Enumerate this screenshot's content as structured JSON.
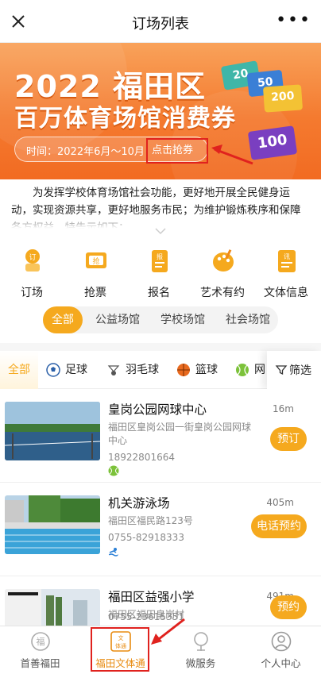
{
  "titlebar": {
    "title": "订场列表"
  },
  "banner": {
    "line1": "2022 福田区",
    "line2": "百万体育场馆消费券",
    "time": "时间：2022年6月～10月",
    "grab_label": "点击抢券",
    "coupons": [
      "20",
      "50",
      "200",
      "100"
    ]
  },
  "notice": {
    "text": "为发挥学校体育场馆社会功能，更好地开展全民健身运动，实现资源共享，更好地服务市民；为维护锻炼秩序和保障各方权益，特告示如下："
  },
  "nav_icons": [
    {
      "label": "订场",
      "color": "#f5a91e"
    },
    {
      "label": "抢票",
      "color": "#f5a91e"
    },
    {
      "label": "报名",
      "color": "#f5a91e"
    },
    {
      "label": "艺术有约",
      "color": "#f5a91e"
    },
    {
      "label": "文体信息",
      "color": "#f5a91e"
    }
  ],
  "venue_filters": {
    "items": [
      "全部",
      "公益场馆",
      "学校场馆",
      "社会场馆"
    ],
    "active": "全部"
  },
  "sports": {
    "items": [
      "全部",
      "足球",
      "羽毛球",
      "篮球",
      "网"
    ],
    "active": "全部",
    "filter_label": "筛选"
  },
  "venues": [
    {
      "name": "皇岗公园网球中心",
      "distance": "16m",
      "address": "福田区皇岗公园一街皇岗公园网球中心",
      "phone": "18922801664",
      "action": "预订",
      "sport_icon": "tennis-ball-icon"
    },
    {
      "name": "机关游泳场",
      "distance": "405m",
      "address": "福田区福民路123号",
      "phone": "0755-82918333",
      "action": "电话预约",
      "sport_icon": "swimmer-icon"
    },
    {
      "name": "福田区益强小学",
      "distance": "491m",
      "address": "福田区福田皇岗村",
      "phone": "0755-23615351",
      "action": "预约",
      "sport_icon": "tennis-ball-icon"
    }
  ],
  "tabbar": {
    "items": [
      "首善福田",
      "福田文体通",
      "微服务",
      "个人中心"
    ],
    "active": "福田文体通",
    "active_icon_text": "文体通"
  },
  "colors": {
    "accent": "#f5a91e",
    "banner": "#f47a2f",
    "highlight_box": "#e0221e"
  }
}
